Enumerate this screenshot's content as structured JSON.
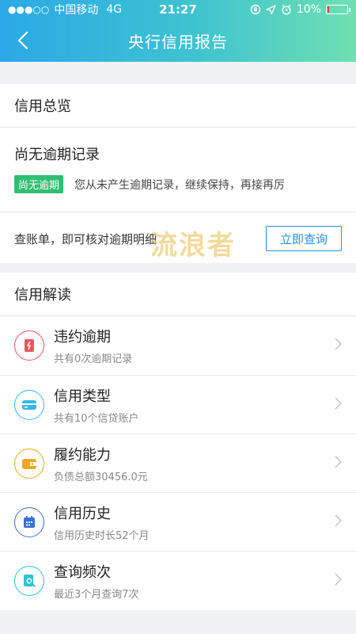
{
  "status_bar": {
    "carrier": "中国移动",
    "network": "4G",
    "time": "21:27",
    "battery_text": "10%",
    "battery_level": 0.1,
    "signal_icon": "signal-dots-icon",
    "lock_rotation_icon": "orientation-lock-icon",
    "location_icon": "location-arrow-icon",
    "alarm_icon": "alarm-clock-icon"
  },
  "nav": {
    "title": "央行信用报告",
    "back_icon": "back-chevron-icon"
  },
  "overview": {
    "section_title": "信用总览",
    "record_title": "尚无逾期记录",
    "badge": "尚无逾期",
    "record_desc": "您从未产生逾期记录，继续保持，再接再厉",
    "query_text": "查账单，即可核对逾期明细",
    "watermark": "流浪者",
    "query_button": "立即查询"
  },
  "interpretation": {
    "section_title": "信用解读",
    "items": [
      {
        "title": "违约逾期",
        "subtitle": "共有0次逾期记录",
        "icon": "overdue-card-icon",
        "color": "#f2545b"
      },
      {
        "title": "信用类型",
        "subtitle": "共有10个信贷账户",
        "icon": "credit-card-icon",
        "color": "#35b8e8"
      },
      {
        "title": "履约能力",
        "subtitle": "负债总额30456.0元",
        "icon": "wallet-icon",
        "color": "#f5a623"
      },
      {
        "title": "信用历史",
        "subtitle": "信用历史时长52个月",
        "icon": "calendar-icon",
        "color": "#3b6fd8"
      },
      {
        "title": "查询频次",
        "subtitle": "最近3个月查询7次",
        "icon": "search-document-icon",
        "color": "#2fc3d0"
      }
    ]
  },
  "colors": {
    "header_gradient_start": "#2aa9e6",
    "header_gradient_end": "#6fe0b1",
    "badge_green": "#2fbf71",
    "link_blue": "#2a8fe0",
    "page_bg": "#f0f1f5"
  }
}
